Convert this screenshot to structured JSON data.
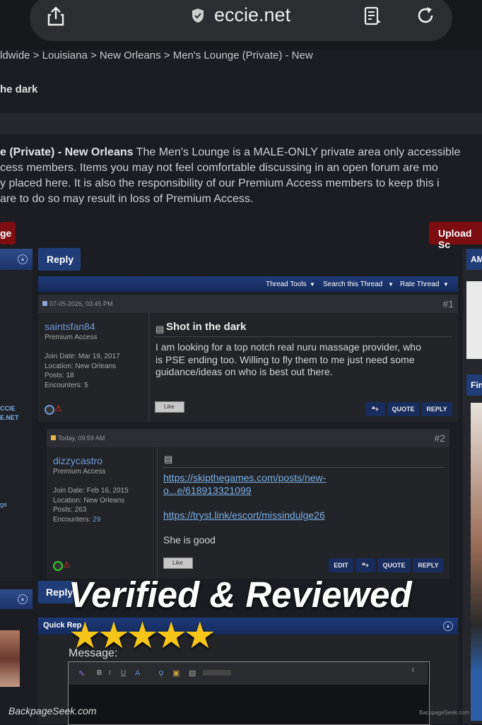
{
  "browser": {
    "url": "eccie.net",
    "icons": [
      "share-icon",
      "shield-icon",
      "reader-icon",
      "reload-icon"
    ]
  },
  "breadcrumb": "ldwide > Louisiana > New Orleans > Men's Lounge (Private) - New",
  "thread_title_top": "he dark",
  "forum_desc": {
    "bold": "e (Private) - New Orleans",
    "line1": " The Men's Lounge is a MALE-ONLY private area only accessible",
    "line2": "cess members. Items you may not feel comfortable discussing in an open forum are mo",
    "line3": "y placed here. It is also the responsibility of our Premium Access members to keep this i",
    "line4": "are to do so may result in loss of Premium Access."
  },
  "buttons": {
    "left_red": "ge",
    "upload": "Upload Sc",
    "reply": "Reply",
    "reply2": "Reply"
  },
  "thread_tools": [
    "Thread Tools",
    "Search this Thread",
    "Rate Thread"
  ],
  "left_sidebar": {
    "text1": "CCIE",
    "text2": "E.NET",
    "text3": "ge"
  },
  "right_sidebar": {
    "label1": "AM",
    "label2": "Fin"
  },
  "posts": [
    {
      "date": "07-05-2026, 03:45 PM",
      "number": "#1",
      "username": "saintsfan84",
      "role": "Premium Access",
      "join": "Join Date: Mar 19, 2017",
      "location": "Location: New Orleans",
      "posts": "Posts: 18",
      "encounters": "Encounters: 5",
      "title": "Shot in the dark",
      "body1": "I am looking for a top notch real nuru massage provider, who",
      "body2": "is PSE ending too. Willing to fly them to me just need some",
      "body3": "guidance/ideas on who is best out there.",
      "like": "Like",
      "quote": "QUOTE",
      "reply": "REPLY"
    },
    {
      "date": "Today, 09:59 AM",
      "number": "#2",
      "username": "dizzycastro",
      "role": "Premium Access",
      "join": "Join Date: Feb 16, 2015",
      "location": "Location: New Orleans",
      "posts": "Posts: 263",
      "encounters_label": "Encounters: ",
      "encounters_val": "29",
      "link1a": "https://skipthegames.com/posts/new-",
      "link1b": "o...e/618913321099",
      "link2": "https://tryst.link/escort/missindulge26",
      "body": "She is good",
      "like": "Like",
      "edit": "EDIT",
      "quote": "QUOTE",
      "reply": "REPLY"
    }
  ],
  "quick_reply": {
    "header": "Quick Rep",
    "message_label": "Message:"
  },
  "overlay": {
    "headline": "Verified & Reviewed",
    "stars": "★★★★★"
  },
  "watermark": {
    "left": "BackpageSeek.com",
    "right": "BackpageSeek.com"
  },
  "colors": {
    "accent_blue": "#213d78",
    "accent_red": "#7c0d10",
    "link": "#7ab0e8",
    "star": "#f5c518"
  }
}
